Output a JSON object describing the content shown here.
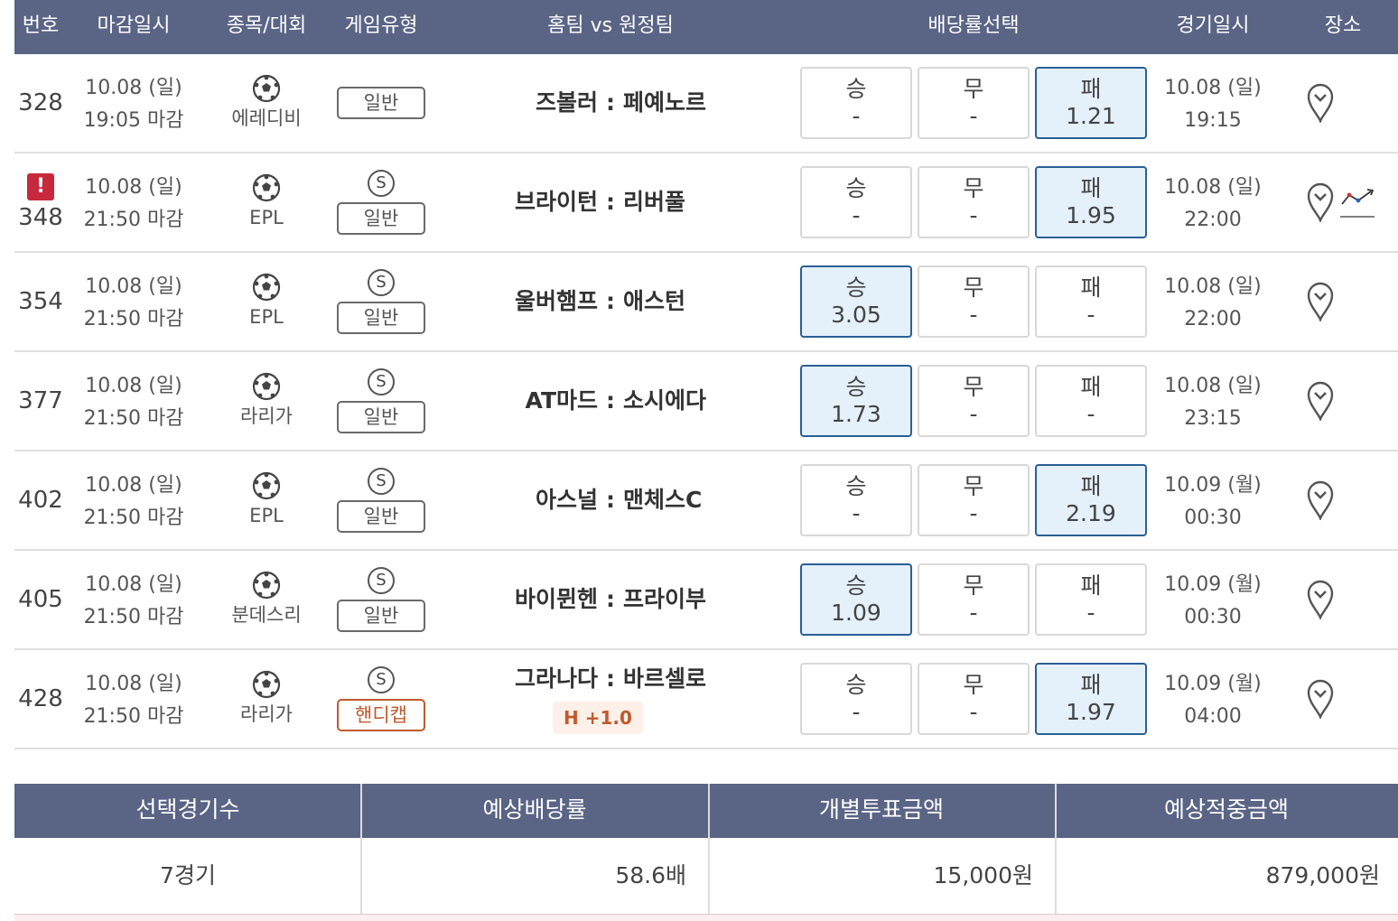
{
  "header": {
    "num": "번호",
    "deadline": "마감일시",
    "league": "종목/대회",
    "game_type": "게임유형",
    "matchup": "홈팀 vs 원정팀",
    "odds": "배당률선택",
    "game_date": "경기일시",
    "venue": "장소"
  },
  "odds_labels": {
    "win": "승",
    "draw": "무",
    "lose": "패"
  },
  "match_separator": ":",
  "special_badge": "S",
  "alert_mark": "!",
  "rows": [
    {
      "num": "328",
      "alert": false,
      "dl_date": "10.08 (일)",
      "dl_time": "19:05 마감",
      "league": "에레디비",
      "special": false,
      "game_type": "일반",
      "handicap": false,
      "home": "즈볼러",
      "away": "페예노르",
      "hc_label": "",
      "odds": {
        "win": "-",
        "draw": "-",
        "lose": "1.21"
      },
      "selected": "lose",
      "gd_date": "10.08 (일)",
      "gd_time": "19:15",
      "trend": false
    },
    {
      "num": "348",
      "alert": true,
      "dl_date": "10.08 (일)",
      "dl_time": "21:50 마감",
      "league": "EPL",
      "special": true,
      "game_type": "일반",
      "handicap": false,
      "home": "브라이턴",
      "away": "리버풀",
      "hc_label": "",
      "odds": {
        "win": "-",
        "draw": "-",
        "lose": "1.95"
      },
      "selected": "lose",
      "gd_date": "10.08 (일)",
      "gd_time": "22:00",
      "trend": true
    },
    {
      "num": "354",
      "alert": false,
      "dl_date": "10.08 (일)",
      "dl_time": "21:50 마감",
      "league": "EPL",
      "special": true,
      "game_type": "일반",
      "handicap": false,
      "home": "울버햄프",
      "away": "애스턴",
      "hc_label": "",
      "odds": {
        "win": "3.05",
        "draw": "-",
        "lose": "-"
      },
      "selected": "win",
      "gd_date": "10.08 (일)",
      "gd_time": "22:00",
      "trend": false
    },
    {
      "num": "377",
      "alert": false,
      "dl_date": "10.08 (일)",
      "dl_time": "21:50 마감",
      "league": "라리가",
      "special": true,
      "game_type": "일반",
      "handicap": false,
      "home": "AT마드",
      "away": "소시에다",
      "hc_label": "",
      "odds": {
        "win": "1.73",
        "draw": "-",
        "lose": "-"
      },
      "selected": "win",
      "gd_date": "10.08 (일)",
      "gd_time": "23:15",
      "trend": false
    },
    {
      "num": "402",
      "alert": false,
      "dl_date": "10.08 (일)",
      "dl_time": "21:50 마감",
      "league": "EPL",
      "special": true,
      "game_type": "일반",
      "handicap": false,
      "home": "아스널",
      "away": "맨체스C",
      "hc_label": "",
      "odds": {
        "win": "-",
        "draw": "-",
        "lose": "2.19"
      },
      "selected": "lose",
      "gd_date": "10.09 (월)",
      "gd_time": "00:30",
      "trend": false
    },
    {
      "num": "405",
      "alert": false,
      "dl_date": "10.08 (일)",
      "dl_time": "21:50 마감",
      "league": "분데스리",
      "special": true,
      "game_type": "일반",
      "handicap": false,
      "home": "바이뮌헨",
      "away": "프라이부",
      "hc_label": "",
      "odds": {
        "win": "1.09",
        "draw": "-",
        "lose": "-"
      },
      "selected": "win",
      "gd_date": "10.09 (월)",
      "gd_time": "00:30",
      "trend": false
    },
    {
      "num": "428",
      "alert": false,
      "dl_date": "10.08 (일)",
      "dl_time": "21:50 마감",
      "league": "라리가",
      "special": true,
      "game_type": "핸디캡",
      "handicap": true,
      "home": "그라나다",
      "away": "바르셀로",
      "hc_label": "H +1.0",
      "odds": {
        "win": "-",
        "draw": "-",
        "lose": "1.97"
      },
      "selected": "lose",
      "gd_date": "10.09 (월)",
      "gd_time": "04:00",
      "trend": false
    }
  ],
  "summary": {
    "headers": {
      "count": "선택경기수",
      "odds": "예상배당률",
      "bet": "개별투표금액",
      "payout": "예상적중금액"
    },
    "values": {
      "count": "7경기",
      "odds": "58.6배",
      "bet": "15,000원",
      "payout": "879,000원"
    }
  },
  "colors": {
    "header_bg": "#5a6485",
    "selected_border": "#2a5f95",
    "selected_bg": "#e4f0fa",
    "alert": "#c8283d",
    "handicap": "#c05a2e"
  },
  "icons": {
    "league": "soccer-ball-icon",
    "venue": "map-pin-icon",
    "trend": "trend-chart-icon",
    "alert": "alert-icon"
  }
}
